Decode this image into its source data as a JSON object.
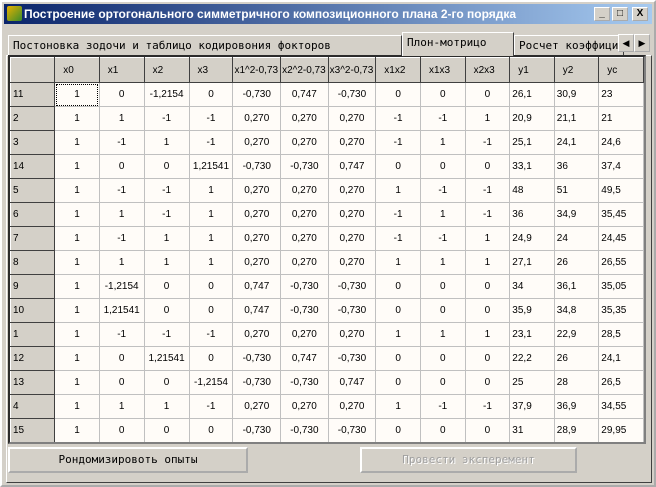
{
  "window": {
    "title": "Построение ортогонального симметричного композиционного плана 2-го порядка",
    "minimize": "_",
    "maximize": "□",
    "close": "X"
  },
  "tabs": [
    {
      "label": "Постоновка зодочи и таблицо кодировония фокторов"
    },
    {
      "label": "Плон-мотрицо"
    },
    {
      "label": "Росчет коэффициентов"
    }
  ],
  "tab_scroll": {
    "left": "◀",
    "right": "▶"
  },
  "table": {
    "columns": [
      "",
      "x0",
      "x1",
      "x2",
      "x3",
      "x1^2-0,73",
      "x2^2-0,73",
      "x3^2-0,73",
      "x1x2",
      "x1x3",
      "x2x3",
      "y1",
      "y2",
      "yc"
    ],
    "rows": [
      [
        "11",
        "1",
        "0",
        "-1,2154",
        "0",
        "-0,730",
        "0,747",
        "-0,730",
        "0",
        "0",
        "0",
        "26,1",
        "30,9",
        "23"
      ],
      [
        "2",
        "1",
        "1",
        "-1",
        "-1",
        "0,270",
        "0,270",
        "0,270",
        "-1",
        "-1",
        "1",
        "20,9",
        "21,1",
        "21"
      ],
      [
        "3",
        "1",
        "-1",
        "1",
        "-1",
        "0,270",
        "0,270",
        "0,270",
        "-1",
        "1",
        "-1",
        "25,1",
        "24,1",
        "24,6"
      ],
      [
        "14",
        "1",
        "0",
        "0",
        "1,21541",
        "-0,730",
        "-0,730",
        "0,747",
        "0",
        "0",
        "0",
        "33,1",
        "36",
        "37,4"
      ],
      [
        "5",
        "1",
        "-1",
        "-1",
        "1",
        "0,270",
        "0,270",
        "0,270",
        "1",
        "-1",
        "-1",
        "48",
        "51",
        "49,5"
      ],
      [
        "6",
        "1",
        "1",
        "-1",
        "1",
        "0,270",
        "0,270",
        "0,270",
        "-1",
        "1",
        "-1",
        "36",
        "34,9",
        "35,45"
      ],
      [
        "7",
        "1",
        "-1",
        "1",
        "1",
        "0,270",
        "0,270",
        "0,270",
        "-1",
        "-1",
        "1",
        "24,9",
        "24",
        "24,45"
      ],
      [
        "8",
        "1",
        "1",
        "1",
        "1",
        "0,270",
        "0,270",
        "0,270",
        "1",
        "1",
        "1",
        "27,1",
        "26",
        "26,55"
      ],
      [
        "9",
        "1",
        "-1,2154",
        "0",
        "0",
        "0,747",
        "-0,730",
        "-0,730",
        "0",
        "0",
        "0",
        "34",
        "36,1",
        "35,05"
      ],
      [
        "10",
        "1",
        "1,21541",
        "0",
        "0",
        "0,747",
        "-0,730",
        "-0,730",
        "0",
        "0",
        "0",
        "35,9",
        "34,8",
        "35,35"
      ],
      [
        "1",
        "1",
        "-1",
        "-1",
        "-1",
        "0,270",
        "0,270",
        "0,270",
        "1",
        "1",
        "1",
        "23,1",
        "22,9",
        "28,5"
      ],
      [
        "12",
        "1",
        "0",
        "1,21541",
        "0",
        "-0,730",
        "0,747",
        "-0,730",
        "0",
        "0",
        "0",
        "22,2",
        "26",
        "24,1"
      ],
      [
        "13",
        "1",
        "0",
        "0",
        "-1,2154",
        "-0,730",
        "-0,730",
        "0,747",
        "0",
        "0",
        "0",
        "25",
        "28",
        "26,5"
      ],
      [
        "4",
        "1",
        "1",
        "1",
        "-1",
        "0,270",
        "0,270",
        "0,270",
        "1",
        "-1",
        "-1",
        "37,9",
        "36,9",
        "34,55"
      ],
      [
        "15",
        "1",
        "0",
        "0",
        "0",
        "-0,730",
        "-0,730",
        "-0,730",
        "0",
        "0",
        "0",
        "31",
        "28,9",
        "29,95"
      ]
    ]
  },
  "buttons": {
    "randomize": "Рондомизировоть опыты",
    "run": "Провести эксперемент"
  }
}
